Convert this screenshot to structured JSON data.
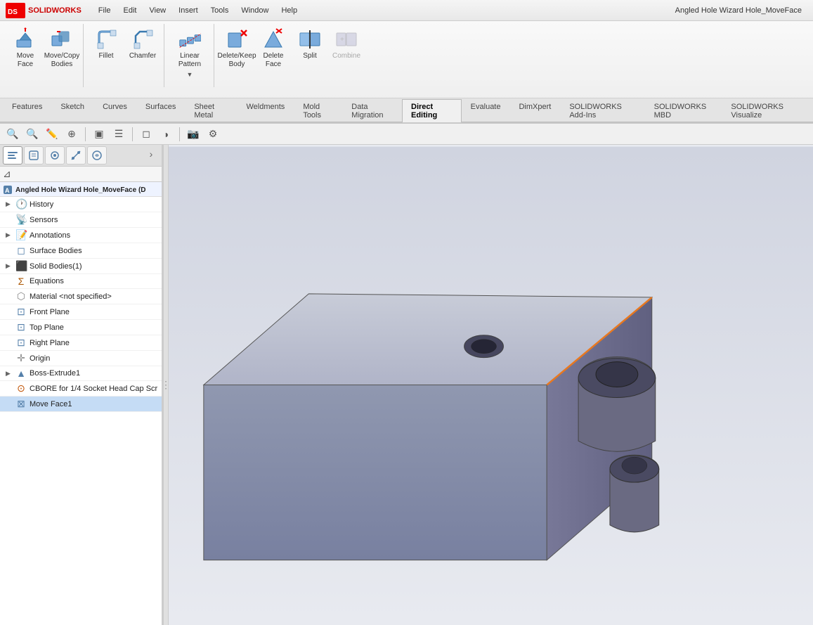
{
  "titlebar": {
    "app_name": "SOLIDWORKS",
    "title": "Angled Hole Wizard Hole_MoveFace",
    "menu_items": [
      "File",
      "Edit",
      "View",
      "Insert",
      "Tools",
      "Window",
      "Help"
    ]
  },
  "toolbar": {
    "groups": [
      {
        "name": "move",
        "buttons": [
          {
            "id": "move-face",
            "label": "Move\nFace",
            "icon": "move"
          },
          {
            "id": "move-copy-bodies",
            "label": "Move/Copy\nBodies",
            "icon": "move-copy"
          }
        ]
      },
      {
        "name": "fillets",
        "buttons": [
          {
            "id": "fillet",
            "label": "Fillet",
            "icon": "fillet"
          },
          {
            "id": "chamfer",
            "label": "Chamfer",
            "icon": "chamfer"
          }
        ]
      },
      {
        "name": "pattern",
        "buttons": [
          {
            "id": "linear-pattern",
            "label": "Linear\nPattern",
            "icon": "pattern",
            "has_arrow": true
          }
        ]
      },
      {
        "name": "modify",
        "buttons": [
          {
            "id": "delete-keep-body",
            "label": "Delete/Keep\nBody",
            "icon": "delete-body"
          },
          {
            "id": "delete-face",
            "label": "Delete\nFace",
            "icon": "delete-face"
          },
          {
            "id": "split",
            "label": "Split",
            "icon": "split"
          },
          {
            "id": "combine",
            "label": "Combine",
            "icon": "combine",
            "disabled": true
          }
        ]
      }
    ]
  },
  "tabs": {
    "items": [
      {
        "id": "features",
        "label": "Features"
      },
      {
        "id": "sketch",
        "label": "Sketch"
      },
      {
        "id": "curves",
        "label": "Curves"
      },
      {
        "id": "surfaces",
        "label": "Surfaces"
      },
      {
        "id": "sheet-metal",
        "label": "Sheet Metal"
      },
      {
        "id": "weldments",
        "label": "Weldments"
      },
      {
        "id": "mold-tools",
        "label": "Mold Tools"
      },
      {
        "id": "data-migration",
        "label": "Data Migration"
      },
      {
        "id": "direct-editing",
        "label": "Direct Editing",
        "active": true
      },
      {
        "id": "evaluate",
        "label": "Evaluate"
      },
      {
        "id": "dimxpert",
        "label": "DimXpert"
      },
      {
        "id": "solidworks-addins",
        "label": "SOLIDWORKS Add-Ins"
      },
      {
        "id": "solidworks-mbd",
        "label": "SOLIDWORKS MBD"
      },
      {
        "id": "solidworks-visualize",
        "label": "SOLIDWORKS Visualize"
      }
    ]
  },
  "feature_tree": {
    "root_label": "Angled Hole Wizard Hole_MoveFace  (D",
    "items": [
      {
        "id": "history",
        "label": "History",
        "icon": "clock",
        "arrow": true,
        "indent": 0
      },
      {
        "id": "sensors",
        "label": "Sensors",
        "icon": "sensor",
        "indent": 0
      },
      {
        "id": "annotations",
        "label": "Annotations",
        "icon": "annotation",
        "arrow": true,
        "indent": 0
      },
      {
        "id": "surface-bodies",
        "label": "Surface Bodies",
        "icon": "surface",
        "indent": 0
      },
      {
        "id": "solid-bodies",
        "label": "Solid Bodies(1)",
        "icon": "solid",
        "arrow": true,
        "indent": 0
      },
      {
        "id": "equations",
        "label": "Equations",
        "icon": "equation",
        "indent": 0
      },
      {
        "id": "material",
        "label": "Material <not specified>",
        "icon": "material",
        "indent": 0
      },
      {
        "id": "front-plane",
        "label": "Front Plane",
        "icon": "plane",
        "indent": 0
      },
      {
        "id": "top-plane",
        "label": "Top Plane",
        "icon": "plane",
        "indent": 0
      },
      {
        "id": "right-plane",
        "label": "Right Plane",
        "icon": "plane",
        "indent": 0
      },
      {
        "id": "origin",
        "label": "Origin",
        "icon": "origin",
        "indent": 0
      },
      {
        "id": "boss-extrude1",
        "label": "Boss-Extrude1",
        "icon": "extrude",
        "arrow": true,
        "indent": 0
      },
      {
        "id": "cbore",
        "label": "CBORE for 1/4 Socket Head Cap Scr",
        "icon": "hole",
        "indent": 0
      },
      {
        "id": "move-face1",
        "label": "Move Face1",
        "icon": "move-face",
        "indent": 0,
        "selected": true
      }
    ]
  },
  "secondary_toolbar": {
    "buttons": [
      "🔍",
      "🔍",
      "✏️",
      "⊕",
      "⊗",
      "⊙",
      "▣",
      "⊞",
      "⊟",
      "⋯"
    ]
  }
}
